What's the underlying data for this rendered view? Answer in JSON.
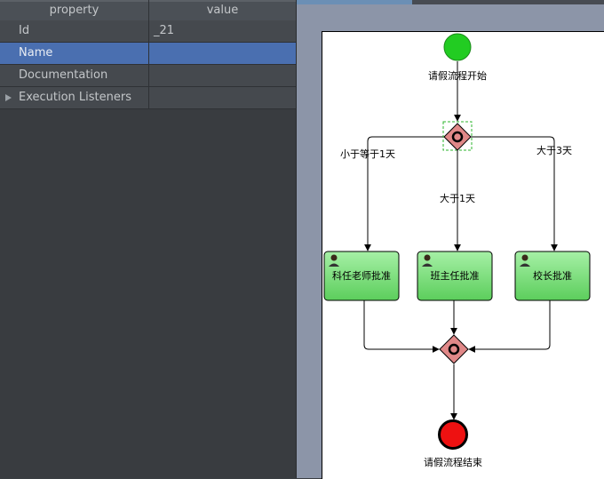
{
  "properties": {
    "headers": {
      "property": "property",
      "value": "value"
    },
    "rows": [
      {
        "key": "Id",
        "value": "_21"
      },
      {
        "key": "Name",
        "value": ""
      },
      {
        "key": "Documentation",
        "value": ""
      },
      {
        "key": "Execution Listeners",
        "value": ""
      }
    ]
  },
  "diagram": {
    "start_label": "请假流程开始",
    "end_label": "请假流程结束",
    "flow_left": "小于等于1天",
    "flow_middle": "大于1天",
    "flow_right": "大于3天",
    "task_left": "科任老师批准",
    "task_middle": "班主任批准",
    "task_right": "校长批准",
    "colors": {
      "start": "#22cc22",
      "end": "#ee1111",
      "gateway": "#e08888",
      "task": "#77dd77"
    }
  }
}
